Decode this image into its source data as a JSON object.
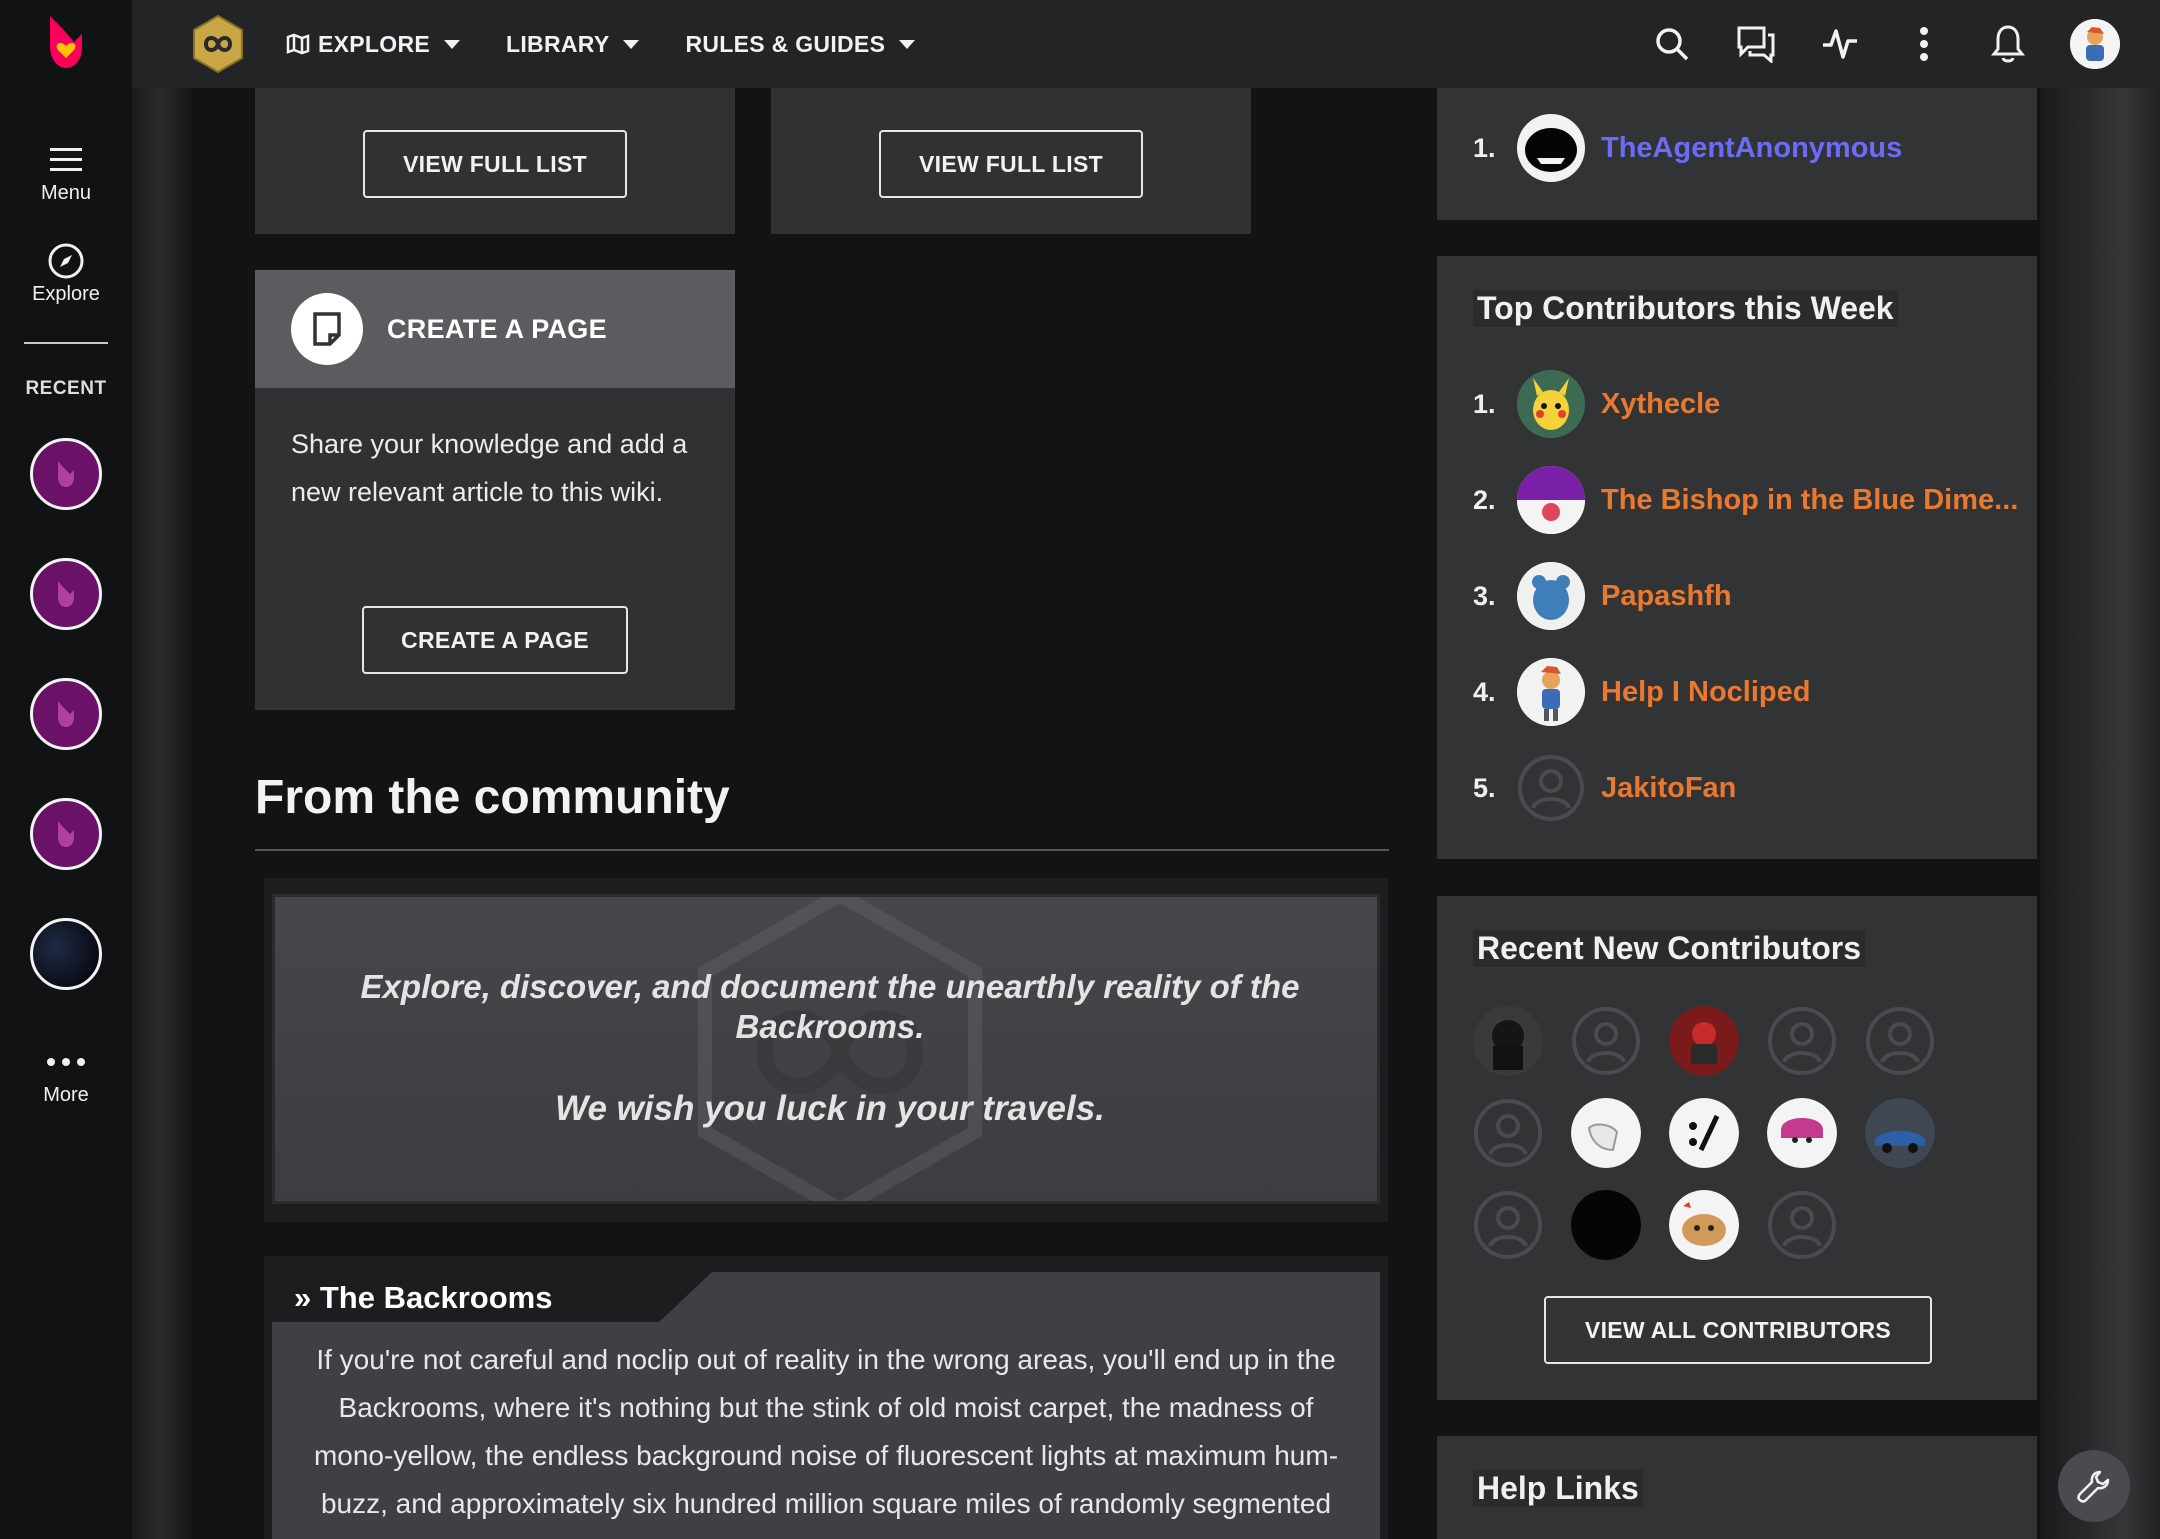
{
  "global_nav": {
    "menu_label": "Menu",
    "explore_label": "Explore",
    "recent_label": "RECENT",
    "more_label": "More",
    "recent_items": [
      "fandom-wiki-1",
      "fandom-wiki-2",
      "fandom-wiki-3",
      "fandom-wiki-4",
      "night-wiki"
    ]
  },
  "header": {
    "nav": [
      {
        "label": "EXPLORE",
        "icon": "map-icon"
      },
      {
        "label": "LIBRARY"
      },
      {
        "label": "RULES & GUIDES"
      }
    ],
    "icons": [
      "search-icon",
      "discussions-icon",
      "activity-icon",
      "more-vertical-icon",
      "bell-icon"
    ]
  },
  "cards": {
    "view_full_list_left": "VIEW FULL LIST",
    "view_full_list_right": "VIEW FULL LIST",
    "create_page": {
      "title": "CREATE A PAGE",
      "description": "Share your knowledge and add a new relevant article to this wiki.",
      "button": "CREATE A PAGE"
    }
  },
  "community": {
    "title": "From the community",
    "banner_line1": "Explore, discover, and document the unearthly reality of the Backrooms.",
    "banner_line2": "We wish you luck in your travels.",
    "backrooms_title": "» The Backrooms",
    "backrooms_body": "If you're not careful and noclip out of reality in the wrong areas, you'll end up in the Backrooms, where it's nothing but the stink of old moist carpet, the madness of mono-yellow, the endless background noise of fluorescent lights at maximum hum-buzz, and approximately six hundred million square miles of randomly segmented empty rooms to be trapped in. God save you if you hear something"
  },
  "rail": {
    "top_alltime": [
      {
        "rank": "1.",
        "name": "TheAgentAnonymous"
      }
    ],
    "top_week_title": "Top Contributors this Week",
    "top_week": [
      {
        "rank": "1.",
        "name": "Xythecle"
      },
      {
        "rank": "2.",
        "name": "The Bishop in the Blue Dime..."
      },
      {
        "rank": "3.",
        "name": "Papashfh"
      },
      {
        "rank": "4.",
        "name": "Help I Nocliped"
      },
      {
        "rank": "5.",
        "name": "JakitoFan"
      }
    ],
    "new_contrib_title": "Recent New Contributors",
    "view_all_button": "VIEW ALL CONTRIBUTORS",
    "help_links_title": "Help Links"
  },
  "colors": {
    "accent_orange": "#e8792f",
    "link_blue": "#6a6cf6",
    "fandom_pink": "#fa005a",
    "recent_purple": "#6a1168"
  }
}
